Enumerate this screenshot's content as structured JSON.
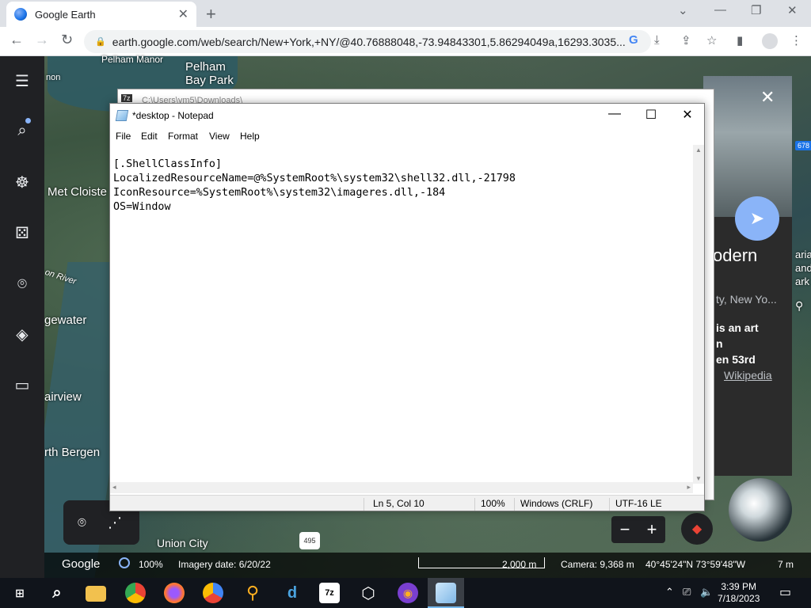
{
  "browser": {
    "tab_title": "Google Earth",
    "tab_close": "✕",
    "new_tab": "+",
    "url": "earth.google.com/web/search/New+York,+NY/@40.76888048,-73.94843301,5.86294049a,16293.3035...",
    "win_min": "⌄",
    "win_minimize": "—",
    "win_restore": "❐",
    "win_close": "✕"
  },
  "map": {
    "labels": {
      "pelham_manor": "Pelham Manor",
      "pelham_bay": "Pelham\nBay Park",
      "non": "non",
      "met_cloisters": "Met Cloiste",
      "hudson_river": "on River",
      "edgewater": "gewater",
      "fairview": "airview",
      "north_bergen": "rth Bergen",
      "union_city": "Union City",
      "highway": "495"
    },
    "side_panel": {
      "title": "odern",
      "subtitle": "ty, New Yo...",
      "body_line1": "is an art",
      "body_line2": "n",
      "body_line3": "en 53rd",
      "wiki_link": "Wikipedia",
      "right_edge_labels": [
        "aria",
        "and",
        "ark"
      ],
      "badge": "678"
    },
    "bottom_bar": {
      "logo": "Google",
      "zoom": "100%",
      "imagery_date": "Imagery date: 6/20/22",
      "scale": "2,000 m",
      "camera": "Camera: 9,368 m",
      "coords": "40°45'24\"N 73°59'48\"W",
      "elevation": "7 m"
    }
  },
  "window_behind": {
    "title": "C:\\Users\\vm5\\Downloads\\"
  },
  "notepad": {
    "title": "*desktop - Notepad",
    "menu": [
      "File",
      "Edit",
      "Format",
      "View",
      "Help"
    ],
    "content": "[.ShellClassInfo]\nLocalizedResourceName=@%SystemRoot%\\system32\\shell32.dll,-21798\nIconResource=%SystemRoot%\\system32\\imageres.dll,-184\nOS=Window",
    "status": {
      "position": "Ln 5, Col 10",
      "zoom": "100%",
      "line_ending": "Windows (CRLF)",
      "encoding": "UTF-16 LE"
    }
  },
  "taskbar": {
    "time": "3:39 PM",
    "date": "7/18/2023"
  }
}
